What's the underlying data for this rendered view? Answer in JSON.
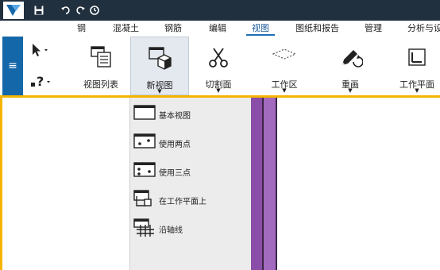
{
  "menu": {
    "items": [
      {
        "label": "钢",
        "active": false
      },
      {
        "label": "混凝土",
        "active": false
      },
      {
        "label": "钢筋",
        "active": false
      },
      {
        "label": "编辑",
        "active": false
      },
      {
        "label": "视图",
        "active": true
      },
      {
        "label": "图纸和报告",
        "active": false
      },
      {
        "label": "管理",
        "active": false
      },
      {
        "label": "分析与设",
        "active": false
      }
    ]
  },
  "ribbon": {
    "view_list": "视图列表",
    "new_view": "新视图",
    "cut_plane": "切割面",
    "work_area": "工作区",
    "redraw": "重画",
    "work_plane": "工作平面"
  },
  "new_view_menu": {
    "items": [
      {
        "label": "基本视图"
      },
      {
        "label": "使用两点"
      },
      {
        "label": "使用三点"
      },
      {
        "label": "在工作平面上"
      },
      {
        "label": "沿轴线"
      }
    ]
  },
  "colors": {
    "titlebar": "#21303f",
    "accent": "#1467a8",
    "work_area_border": "#f5b400",
    "column_purple": "#a26bbf",
    "selected_tool": "#e4e9ef"
  }
}
